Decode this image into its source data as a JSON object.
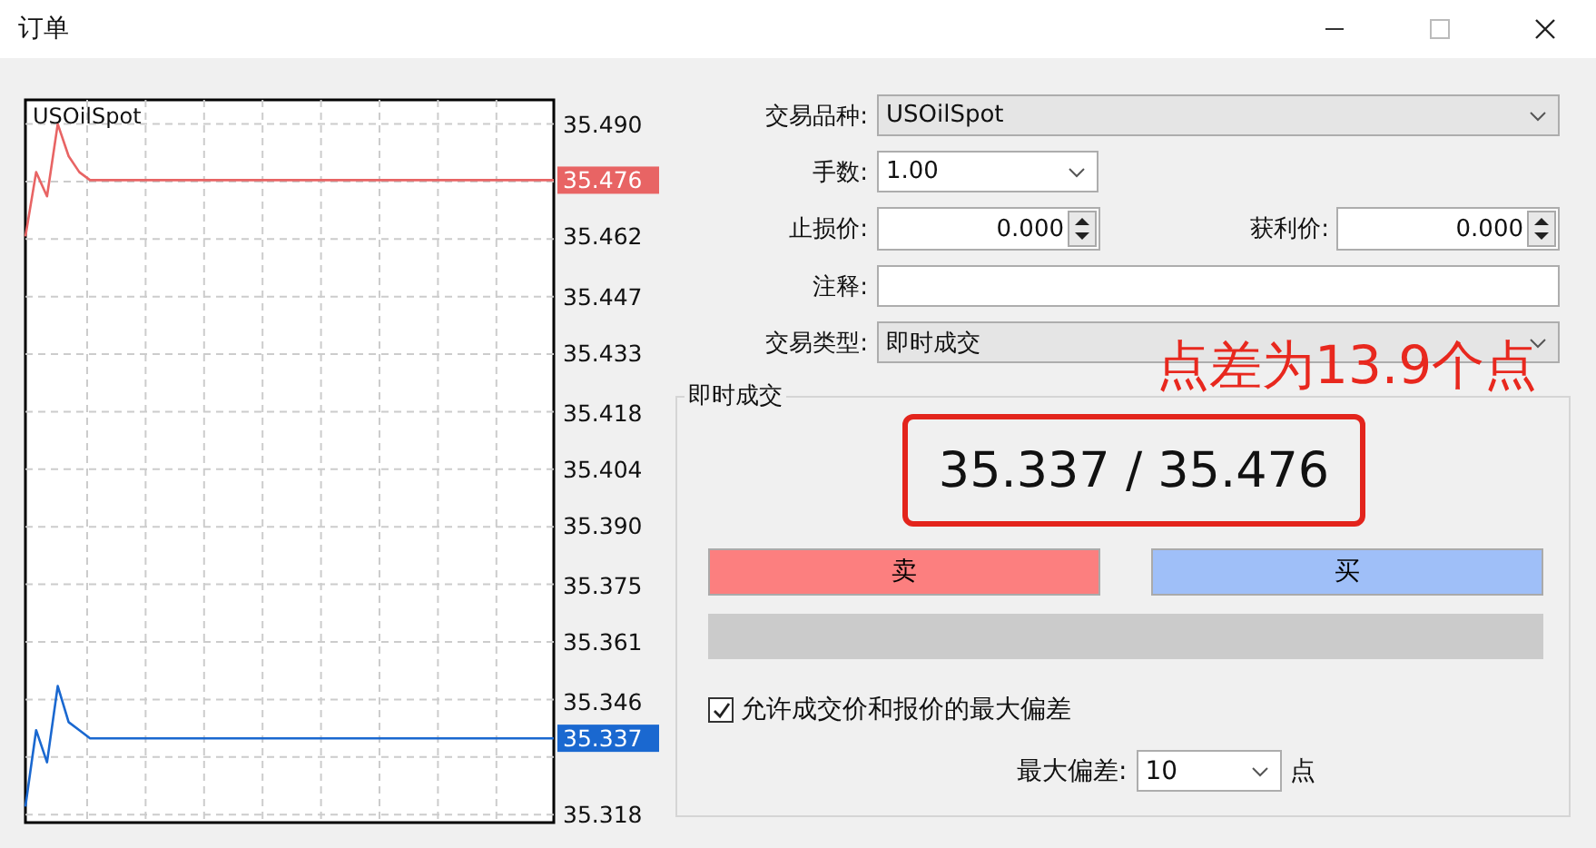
{
  "window": {
    "title": "订单"
  },
  "chart": {
    "symbol": "USOilSpot",
    "chart_data": {
      "type": "line",
      "grid": true,
      "ylim": [
        35.316,
        35.496
      ],
      "yticks": [
        {
          "value": 35.49,
          "label": "35.490"
        },
        {
          "value": 35.462,
          "label": "35.462"
        },
        {
          "value": 35.447,
          "label": "35.447"
        },
        {
          "value": 35.433,
          "label": "35.433"
        },
        {
          "value": 35.418,
          "label": "35.418"
        },
        {
          "value": 35.404,
          "label": "35.404"
        },
        {
          "value": 35.39,
          "label": "35.390"
        },
        {
          "value": 35.375,
          "label": "35.375"
        },
        {
          "value": 35.361,
          "label": "35.361"
        },
        {
          "value": 35.346,
          "label": "35.346"
        },
        {
          "value": 35.318,
          "label": "35.318"
        }
      ],
      "series": [
        {
          "color": "#e86464",
          "values": [
            35.462,
            35.478,
            35.472,
            35.49,
            35.482,
            35.478,
            35.476,
            35.476,
            35.476,
            35.476,
            35.476,
            35.476,
            35.476,
            35.476,
            35.476,
            35.476,
            35.476,
            35.476,
            35.476,
            35.476,
            35.476,
            35.476,
            35.476,
            35.476,
            35.476,
            35.476,
            35.476,
            35.476,
            35.476,
            35.476,
            35.476,
            35.476,
            35.476,
            35.476,
            35.476,
            35.476,
            35.476,
            35.476,
            35.476,
            35.476,
            35.476,
            35.476,
            35.476,
            35.476,
            35.476,
            35.476,
            35.476,
            35.476,
            35.476,
            35.476
          ]
        },
        {
          "color": "#1a68d0",
          "values": [
            35.32,
            35.339,
            35.331,
            35.35,
            35.341,
            35.339,
            35.337,
            35.337,
            35.337,
            35.337,
            35.337,
            35.337,
            35.337,
            35.337,
            35.337,
            35.337,
            35.337,
            35.337,
            35.337,
            35.337,
            35.337,
            35.337,
            35.337,
            35.337,
            35.337,
            35.337,
            35.337,
            35.337,
            35.337,
            35.337,
            35.337,
            35.337,
            35.337,
            35.337,
            35.337,
            35.337,
            35.337,
            35.337,
            35.337,
            35.337,
            35.337,
            35.337,
            35.337,
            35.337,
            35.337,
            35.337,
            35.337,
            35.337,
            35.337,
            35.337
          ]
        }
      ],
      "annotations": [
        "35.476",
        "35.337"
      ]
    }
  },
  "symbol": {
    "label": "交易品种:",
    "value": "USOilSpot",
    "disabled": true
  },
  "volume": {
    "label": "手数:",
    "value": "1.00",
    "disabled": false
  },
  "stop_loss": {
    "label": "止损价:",
    "value": "0.000"
  },
  "take_profit": {
    "label": "获利价:",
    "value": "0.000"
  },
  "comment": {
    "label": "注释:"
  },
  "order_type": {
    "label": "交易类型:",
    "value": "即时成交",
    "disabled": true
  },
  "annotation": {
    "text": "点差为13.9个点"
  },
  "execution": {
    "title": "即时成交",
    "quote": "35.337 / 35.476",
    "sell_button": "卖",
    "buy_button": "买",
    "deviation_checkbox": {
      "label": "允许成交价和报价的最大偏差",
      "checked": true
    },
    "max_deviation": {
      "label": "最大偏差:",
      "value": "10",
      "unit": "点"
    }
  }
}
